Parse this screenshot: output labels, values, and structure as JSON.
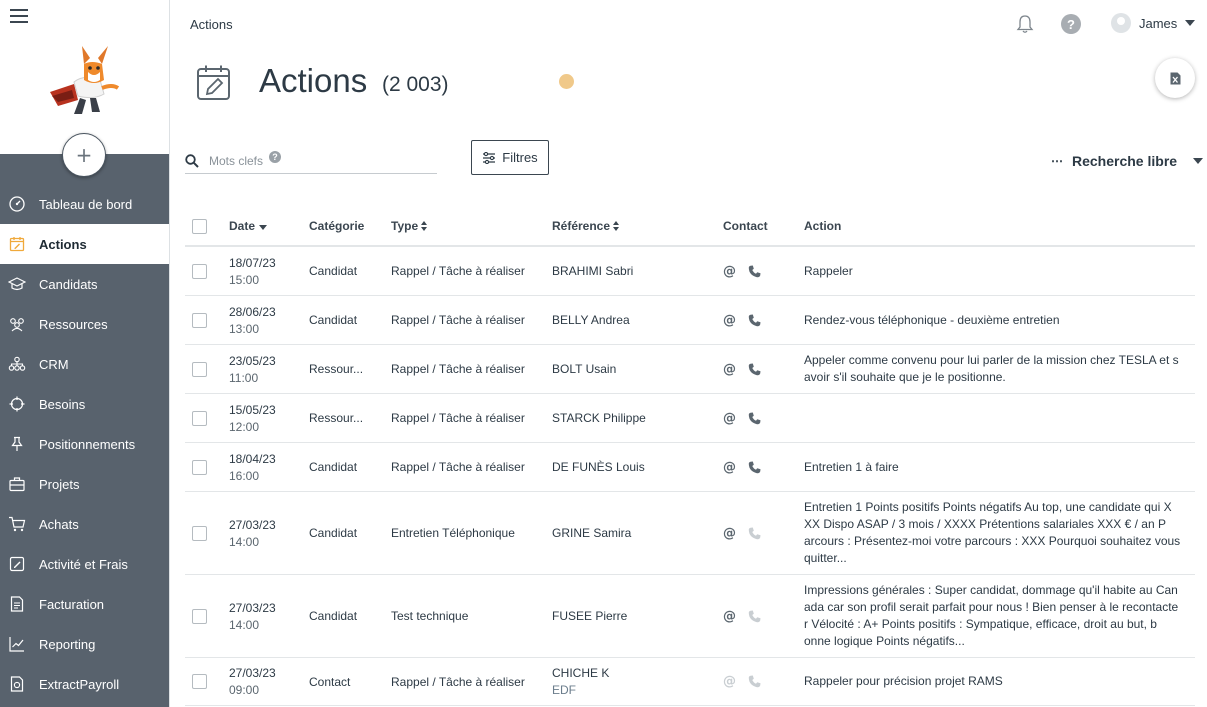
{
  "sidebar": {
    "add_label": "+",
    "items": [
      {
        "label": "Tableau de bord",
        "icon": "dashboard-icon"
      },
      {
        "label": "Actions",
        "icon": "calendar-edit-icon"
      },
      {
        "label": "Candidats",
        "icon": "graduation-cap-icon"
      },
      {
        "label": "Ressources",
        "icon": "people-icon"
      },
      {
        "label": "CRM",
        "icon": "network-icon"
      },
      {
        "label": "Besoins",
        "icon": "crosshair-icon"
      },
      {
        "label": "Positionnements",
        "icon": "pin-icon"
      },
      {
        "label": "Projets",
        "icon": "briefcase-icon"
      },
      {
        "label": "Achats",
        "icon": "cart-icon"
      },
      {
        "label": "Activité et Frais",
        "icon": "edit-box-icon"
      },
      {
        "label": "Facturation",
        "icon": "invoice-icon"
      },
      {
        "label": "Reporting",
        "icon": "chart-line-icon"
      },
      {
        "label": "ExtractPayroll",
        "icon": "payroll-icon"
      }
    ],
    "active_index": 1
  },
  "header": {
    "breadcrumb": "Actions",
    "user_name": "James",
    "help": "?"
  },
  "page": {
    "title": "Actions",
    "count": "(2 003)"
  },
  "search": {
    "placeholder": "Mots clefs",
    "value": "",
    "help": "?"
  },
  "filters_label": "Filtres",
  "free_search_label": "Recherche libre",
  "table": {
    "headers": {
      "date": "Date",
      "category": "Catégorie",
      "type": "Type",
      "reference": "Référence",
      "contact": "Contact",
      "action": "Action"
    },
    "rows": [
      {
        "date": "18/07/23",
        "time": "15:00",
        "category": "Candidat",
        "type": "Rappel / Tâche à réaliser",
        "reference": "BRAHIMI Sabri",
        "ref_sub": "",
        "email": true,
        "phone": true,
        "action": "Rappeler"
      },
      {
        "date": "28/06/23",
        "time": "13:00",
        "category": "Candidat",
        "type": "Rappel / Tâche à réaliser",
        "reference": "BELLY Andrea",
        "ref_sub": "",
        "email": true,
        "phone": true,
        "action": "Rendez-vous téléphonique - deuxième entretien"
      },
      {
        "date": "23/05/23",
        "time": "11:00",
        "category": "Ressour...",
        "type": "Rappel / Tâche à réaliser",
        "reference": "BOLT Usain",
        "ref_sub": "",
        "email": true,
        "phone": true,
        "action": "Appeler comme convenu pour lui parler de la mission chez TESLA et s avoir s'il souhaite que je le positionne."
      },
      {
        "date": "15/05/23",
        "time": "12:00",
        "category": "Ressour...",
        "type": "Rappel / Tâche à réaliser",
        "reference": "STARCK Philippe",
        "ref_sub": "",
        "email": true,
        "phone": true,
        "action": ""
      },
      {
        "date": "18/04/23",
        "time": "16:00",
        "category": "Candidat",
        "type": "Rappel / Tâche à réaliser",
        "reference": "DE FUNÈS Louis",
        "ref_sub": "",
        "email": true,
        "phone": true,
        "action": "Entretien 1 à faire"
      },
      {
        "date": "27/03/23",
        "time": "14:00",
        "category": "Candidat",
        "type": "Entretien Téléphonique",
        "reference": "GRINE Samira",
        "ref_sub": "",
        "email": true,
        "phone": false,
        "action": "Entretien 1 Points positifs Points négatifs Au top, une candidate qui X XX Dispo ASAP / 3 mois / XXXX Prétentions salariales XXX € / an P arcours : Présentez-moi votre parcours : XXX Pourquoi souhaitez vous quitter..."
      },
      {
        "date": "27/03/23",
        "time": "14:00",
        "category": "Candidat",
        "type": "Test technique",
        "reference": "FUSEE Pierre",
        "ref_sub": "",
        "email": true,
        "phone": false,
        "action": "Impressions générales : Super candidat, dommage qu'il habite au Can ada car son profil serait parfait pour nous ! Bien penser à le recontacte r Vélocité : A+ Points positifs : Sympatique, efficace, droit au but, b onne logique Points négatifs..."
      },
      {
        "date": "27/03/23",
        "time": "09:00",
        "category": "Contact",
        "type": "Rappel / Tâche à réaliser",
        "reference": "CHICHE K",
        "ref_sub": "EDF",
        "email": false,
        "phone": false,
        "action": "Rappeler pour précision projet RAMS"
      }
    ]
  },
  "colors": {
    "sidebar": "#58626d",
    "accent": "#f0a93b",
    "text": "#2d3a45"
  }
}
